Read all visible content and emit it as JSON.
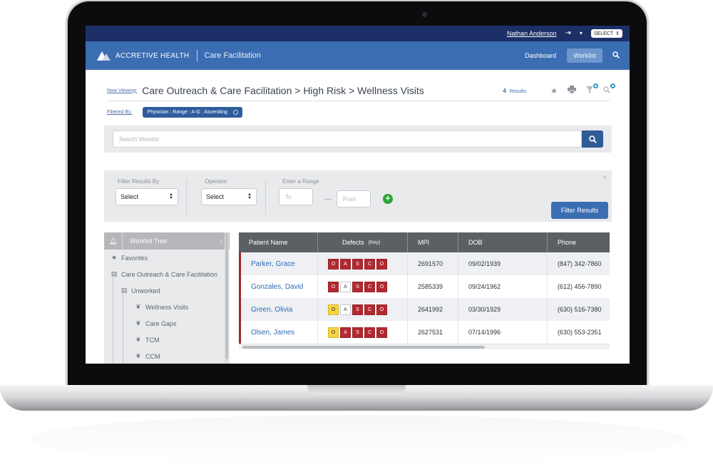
{
  "header": {
    "user_name": "Nathan Anderson",
    "logout_icon": "logout-icon",
    "pin_icon": "pin-icon",
    "select_label": "SELECT",
    "brand": "ACCRETIVE HEALTH",
    "app_name": "Care Facilitation",
    "nav": [
      {
        "label": "Dashboard",
        "active": false
      },
      {
        "label": "Worklist",
        "active": true
      }
    ]
  },
  "viewing": {
    "label": "Now Viewing:",
    "breadcrumb": "Care Outreach & Care Facilitation > High Risk > Wellness Visits",
    "results_count": "4",
    "results_label": "Results"
  },
  "filters": {
    "label": "Filtered By:",
    "chip": "Physician : Range : A-G : Ascending"
  },
  "search": {
    "placeholder": "Search Worklist"
  },
  "filter_panel": {
    "filter_by_label": "Filter Results By",
    "filter_by_value": "Select",
    "operator_label": "Operator",
    "operator_value": "Select",
    "range_label": "Enter a Range",
    "range_to_placeholder": "To",
    "range_dash": "—",
    "range_from_placeholder": "From",
    "close": "×",
    "button": "Filter Results"
  },
  "tree": {
    "title": "Worklist Tree",
    "items": [
      {
        "label": "Favorites",
        "icon": "star-icon"
      },
      {
        "label": "Care Outreach & Care Facilitation",
        "icon": "folder-open-icon"
      },
      {
        "label": "Unworked",
        "icon": "folder-open-icon"
      },
      {
        "label": "Wellness Visits",
        "icon": "leaf-icon"
      },
      {
        "label": "Care Gaps",
        "icon": "leaf-icon"
      },
      {
        "label": "TCM",
        "icon": "leaf-icon"
      },
      {
        "label": "CCM",
        "icon": "leaf-icon"
      }
    ]
  },
  "table": {
    "columns": [
      {
        "label": "Patient Name",
        "note": ""
      },
      {
        "label": "Defects",
        "note": "(Key)"
      },
      {
        "label": "MPI",
        "note": ""
      },
      {
        "label": "DOB",
        "note": ""
      },
      {
        "label": "Phone",
        "note": ""
      }
    ],
    "rows": [
      {
        "name": "Parker, Grace",
        "defects": [
          [
            "O",
            "red"
          ],
          [
            "A",
            "red"
          ],
          [
            "S",
            "red"
          ],
          [
            "C",
            "red"
          ],
          [
            "O",
            "red"
          ]
        ],
        "mpi": "2691570",
        "dob": "09/02/1939",
        "phone": "(847) 342-7860"
      },
      {
        "name": "Gonzales, David",
        "defects": [
          [
            "O",
            "red"
          ],
          [
            "A",
            "white"
          ],
          [
            "S",
            "red"
          ],
          [
            "C",
            "red"
          ],
          [
            "O",
            "red"
          ]
        ],
        "mpi": "2585339",
        "dob": "09/24/1962",
        "phone": "(612) 456-7890"
      },
      {
        "name": "Green, Olivia",
        "defects": [
          [
            "O",
            "yellow"
          ],
          [
            "A",
            "white"
          ],
          [
            "S",
            "red"
          ],
          [
            "C",
            "red"
          ],
          [
            "O",
            "red"
          ]
        ],
        "mpi": "2641992",
        "dob": "03/30/1929",
        "phone": "(630) 516-7380"
      },
      {
        "name": "Olsen, James",
        "defects": [
          [
            "O",
            "yellow"
          ],
          [
            "A",
            "red"
          ],
          [
            "S",
            "red"
          ],
          [
            "C",
            "red"
          ],
          [
            "O",
            "red"
          ]
        ],
        "mpi": "2627531",
        "dob": "07/14/1996",
        "phone": "(630) 553-2351"
      }
    ]
  },
  "colors": {
    "topbar": "#1c2f66",
    "navbar": "#3b6db3",
    "defect_red": "#b3292f",
    "defect_yellow": "#f6d542",
    "link_blue": "#2f6bb3"
  }
}
